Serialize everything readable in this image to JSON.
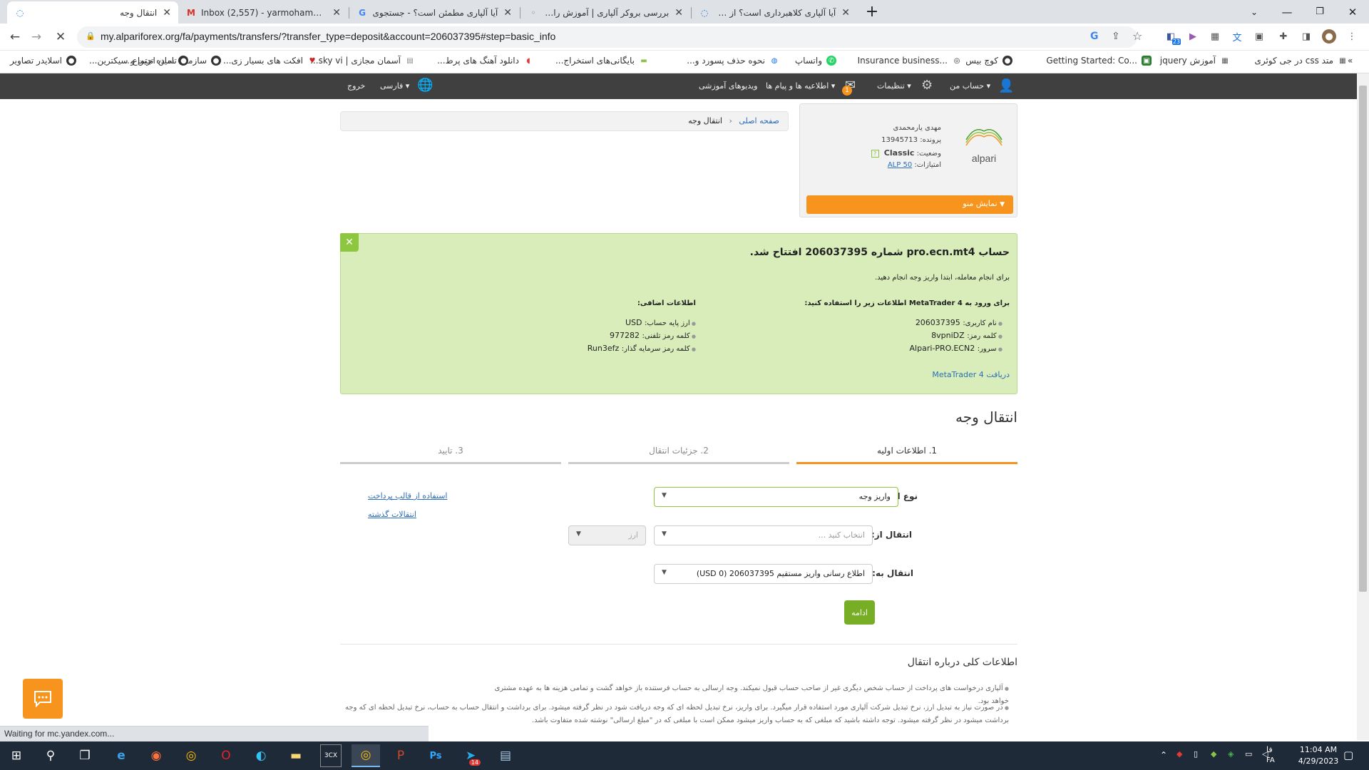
{
  "browser": {
    "tabs": [
      {
        "title": "انتقال وجه",
        "icon": "loading-icon",
        "active": true
      },
      {
        "title": "Inbox (2,557) - yarmohamadi677",
        "icon": "gmail-icon",
        "active": false
      },
      {
        "title": "آیا آلپاری مطمئن است؟ - جستجوی",
        "icon": "google-icon",
        "active": false
      },
      {
        "title": "بررسی بروکر آلپاری | آموزش رایگان و",
        "icon": "site-icon",
        "active": false
      },
      {
        "title": "آیا آلپاری کلاهبرداری است؟ از کجا بد",
        "icon": "loading-icon",
        "active": false
      }
    ],
    "url": "my.alpariforex.org/fa/payments/transfers/?transfer_type=deposit&account=206037395#step=basic_info",
    "bookmarks": [
      "متد css در جی کوئری",
      "آموزش jquery",
      "Getting Started: Co...",
      "کوچ بیس",
      "Insurance business...",
      "واتساپ",
      "نحوه حذف پسورد و...",
      "بایگانی‌های استخراج...",
      "دانلود آهنگ های پرط...",
      "آسمان مجازی | sky vi...",
      "افکت های بسیار زی...",
      "سازمان تامین اجتماع...",
      "ساده ترین و سیکترین...",
      "اسلایدر تصاویر"
    ],
    "status": "Waiting for mc.yandex.com...",
    "ext_badge": "23"
  },
  "sitebar": {
    "my_account": "حساب من",
    "settings": "تنظیمات",
    "messages": "اطلاعیه ها و پیام ها",
    "messages_badge": "1",
    "videos": "ویدیوهای آموزشی",
    "language": "فارسی",
    "logout": "خروج"
  },
  "breadcrumb": {
    "home": "صفحه اصلی",
    "current": "انتقال وجه"
  },
  "profile": {
    "logo_text": "alpari",
    "name": "مهدی یارمحمدی",
    "file_label": "پرونده:",
    "file_value": "13945713",
    "status_label": "وضعیت:",
    "status_value": "Classic",
    "points_label": "امتیازات:",
    "points_value": "ALP 50",
    "menu_button": "نمایش منو"
  },
  "notice": {
    "title_pre": "حساب",
    "account_type": "pro.ecn.mt4",
    "title_mid": "شماره",
    "account_number": "206037395",
    "title_post": "افتتاح شد.",
    "subtitle": "برای انجام معامله، ابتدا واریز وجه انجام دهید.",
    "login_header_pre": "برای ورود به",
    "login_header_platform": "MetaTrader 4",
    "login_header_post": "اطلاعات زیر را استفاده کنید:",
    "extra_header": "اطلاعات اضافی:",
    "login_items": [
      {
        "label": "نام کاربری:",
        "value": "206037395"
      },
      {
        "label": "کلمه رمز:",
        "value": "8vpniDZ"
      },
      {
        "label": "سرور:",
        "value": "Alpari-PRO.ECN2"
      }
    ],
    "extra_items": [
      {
        "label": "ارز پایه حساب:",
        "value": "USD"
      },
      {
        "label": "کلمه رمز تلفنی:",
        "value": "977282"
      },
      {
        "label": "کلمه رمز سرمایه گذار:",
        "value": "Run3efz"
      }
    ],
    "download_link": "دریافت MetaTrader 4"
  },
  "transfer": {
    "title": "انتقال وجه",
    "steps": [
      "1. اطلاعات اولیه",
      "2. جزئیات انتقال",
      "3. تایید"
    ],
    "type_label": "نوع انتقال:",
    "type_value": "واریز وجه",
    "from_label": "انتقال از:",
    "from_placeholder": "انتخاب کنید ...",
    "currency_placeholder": "ارز",
    "to_label": "انتقال به:",
    "to_value": "اطلاع رسانی واریز مستقیم 206037395 (0 USD)",
    "links": [
      "استفاده از قالب پرداخت",
      "انتقالات گذشته"
    ],
    "continue": "ادامه"
  },
  "info": {
    "title": "اطلاعات کلی درباره انتقال",
    "items": [
      "آلپاری درخواست های پرداخت از حساب شخص دیگری غیر از صاحب حساب قبول نمیکند. وجه ارسالی به حساب فرستنده باز خواهد گشت و تمامی هزینه ها به عهده مشتری خواهد بود.",
      "در صورت نیاز به تبدیل ارز، نرخ تبدیل شرکت آلپاری مورد استفاده قرار میگیرد. برای واریز، نرخ تبدیل لحظه ای که وجه دریافت شود در نظر گرفته میشود. برای برداشت و انتقال حساب به حساب، نرخ تبدیل لحظه ای که وجه برداشت میشود در نظر گرفته میشود. توجه داشته باشید که مبلغی که به حساب واریز میشود ممکن است با مبلغی که در \"مبلغ ارسالی\" نوشته شده متفاوت باشد."
    ]
  },
  "taskbar": {
    "time": "11:04 AM",
    "date": "4/29/2023",
    "lang": "FA",
    "lang2": "فا",
    "telegram_badge": "14"
  },
  "colors": {
    "accent_orange": "#f7941d",
    "notice_green": "#d8edba",
    "continue_green": "#78ad26",
    "link_blue": "#2a6ebb"
  }
}
